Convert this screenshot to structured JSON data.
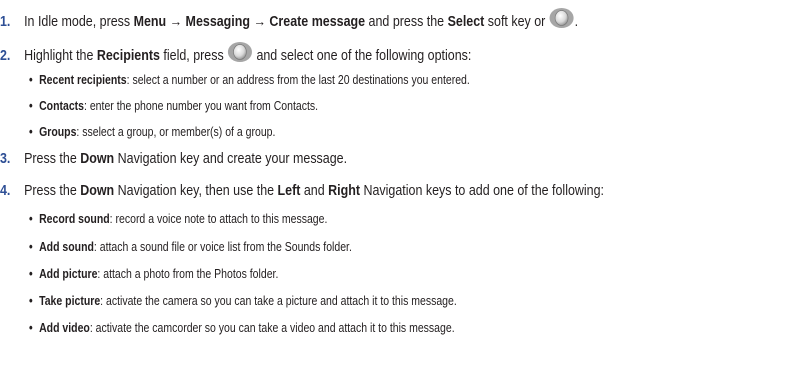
{
  "steps": [
    {
      "num": "1.",
      "parts": [
        "In Idle mode, press ",
        "Menu",
        " ",
        "→",
        " ",
        "Messaging",
        " ",
        "→",
        " ",
        "Create message",
        " and press the ",
        "Select",
        " soft key or ",
        "."
      ]
    },
    {
      "num": "2.",
      "parts": [
        "Highlight the ",
        "Recipients",
        " field, press ",
        " and select one of the following options:"
      ]
    },
    {
      "num": "3.",
      "parts": [
        "Press the ",
        "Down",
        " Navigation key and create your message."
      ]
    },
    {
      "num": "4.",
      "parts": [
        "Press the ",
        "Down",
        " Navigation key, then use the ",
        "Left",
        " and ",
        "Right",
        " Navigation keys to add one of the following:"
      ]
    }
  ],
  "recipient_options": [
    {
      "bullet": "•",
      "term": "Recent recipients",
      "desc": ": select a number or an address from the last 20 destinations you entered."
    },
    {
      "bullet": "•",
      "term": "Contacts",
      "desc": ": enter the phone number you want from Contacts."
    },
    {
      "bullet": "•",
      "term": "Groups",
      "desc": ": sselect a group, or member(s) of a group."
    }
  ],
  "attach_options": [
    {
      "bullet": "•",
      "term": "Record sound",
      "desc": ": record a voice note to attach to this message."
    },
    {
      "bullet": "•",
      "term": "Add sound",
      "desc": ": attach a sound file or voice list from the Sounds folder."
    },
    {
      "bullet": "•",
      "term": "Add picture",
      "desc": ": attach a photo from the Photos folder."
    },
    {
      "bullet": "•",
      "term": "Take picture",
      "desc": ": activate the camera so you can take a picture and attach it to this message."
    },
    {
      "bullet": "•",
      "term": "Add video",
      "desc": ": activate the camcorder so you can take a video and attach it to this message."
    }
  ],
  "icons": {
    "nav_key": "center-select-key-icon"
  }
}
